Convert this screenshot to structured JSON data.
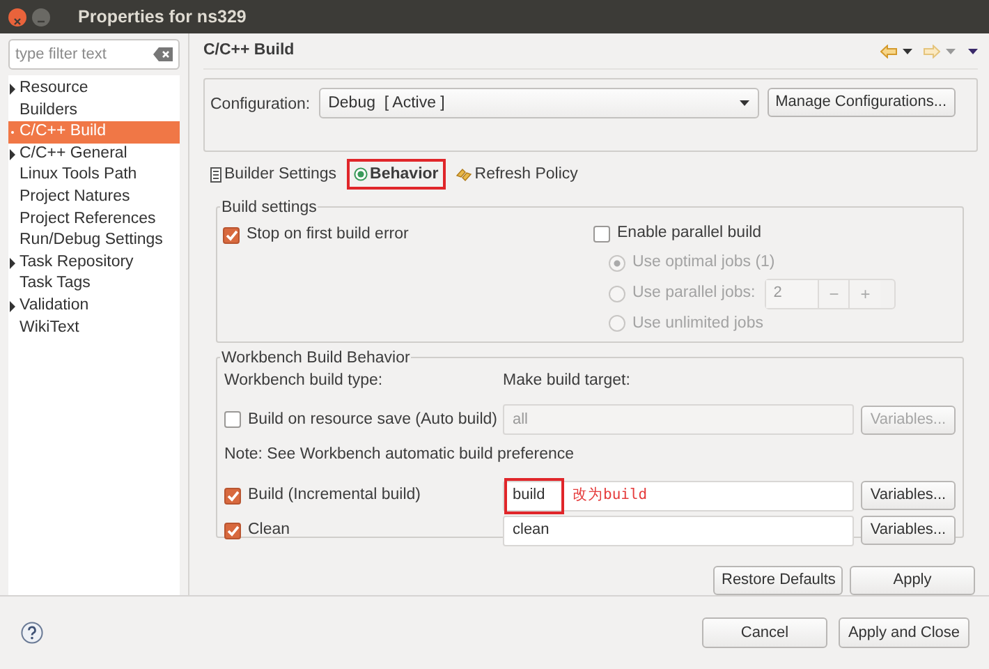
{
  "window": {
    "title": "Properties for ns329"
  },
  "filter": {
    "placeholder": "type filter text"
  },
  "tree": [
    {
      "label": "Resource",
      "expandable": true,
      "selected": false
    },
    {
      "label": "Builders",
      "expandable": false,
      "selected": false
    },
    {
      "label": "C/C++ Build",
      "expandable": true,
      "selected": true
    },
    {
      "label": "C/C++ General",
      "expandable": true,
      "selected": false
    },
    {
      "label": "Linux Tools Path",
      "expandable": false,
      "selected": false
    },
    {
      "label": "Project Natures",
      "expandable": false,
      "selected": false
    },
    {
      "label": "Project References",
      "expandable": false,
      "selected": false
    },
    {
      "label": "Run/Debug Settings",
      "expandable": false,
      "selected": false
    },
    {
      "label": "Task Repository",
      "expandable": true,
      "selected": false
    },
    {
      "label": "Task Tags",
      "expandable": false,
      "selected": false
    },
    {
      "label": "Validation",
      "expandable": true,
      "selected": false
    },
    {
      "label": "WikiText",
      "expandable": false,
      "selected": false
    }
  ],
  "page": {
    "title": "C/C++ Build"
  },
  "configuration": {
    "label": "Configuration:",
    "value": "Debug  [ Active ]",
    "button": "Manage Configurations..."
  },
  "tabs": [
    {
      "label": "Builder Settings",
      "kind": "list",
      "selected": false,
      "highlighted": false
    },
    {
      "label": "Behavior",
      "kind": "radio",
      "selected": true,
      "highlighted": true
    },
    {
      "label": "Refresh Policy",
      "kind": "refresh",
      "selected": false,
      "highlighted": false
    }
  ],
  "build_settings": {
    "title": "Build settings",
    "stop_on_error": {
      "label": "Stop on first build error",
      "checked": true
    },
    "parallel": {
      "label": "Enable parallel build",
      "checked": false
    },
    "jobs": [
      {
        "kind": "plain",
        "label": "Use optimal jobs (1)",
        "selected": true
      },
      {
        "kind": "spinner",
        "label": "Use parallel jobs:",
        "selected": false,
        "value": "2",
        "minus": "−",
        "plus": "+"
      },
      {
        "kind": "plain",
        "label": "Use unlimited jobs",
        "selected": false
      }
    ]
  },
  "workbench": {
    "title": "Workbench Build Behavior",
    "type_label": "Workbench build type:",
    "target_label": "Make build target:",
    "note": "Note: See Workbench automatic build preference",
    "rows": [
      {
        "label": "Build on resource save (Auto build)",
        "checked": false,
        "target": "all",
        "variables": "Variables...",
        "highlighted": false
      },
      {
        "label": "Build (Incremental build)",
        "checked": true,
        "target": "build",
        "variables": "Variables...",
        "highlighted": true,
        "annotation": "改为build"
      },
      {
        "label": "Clean",
        "checked": true,
        "target": "clean",
        "variables": "Variables...",
        "highlighted": false
      }
    ]
  },
  "page_buttons": [
    "Restore Defaults",
    "Apply"
  ],
  "dialog_buttons": [
    "Cancel",
    "Apply and Close"
  ]
}
